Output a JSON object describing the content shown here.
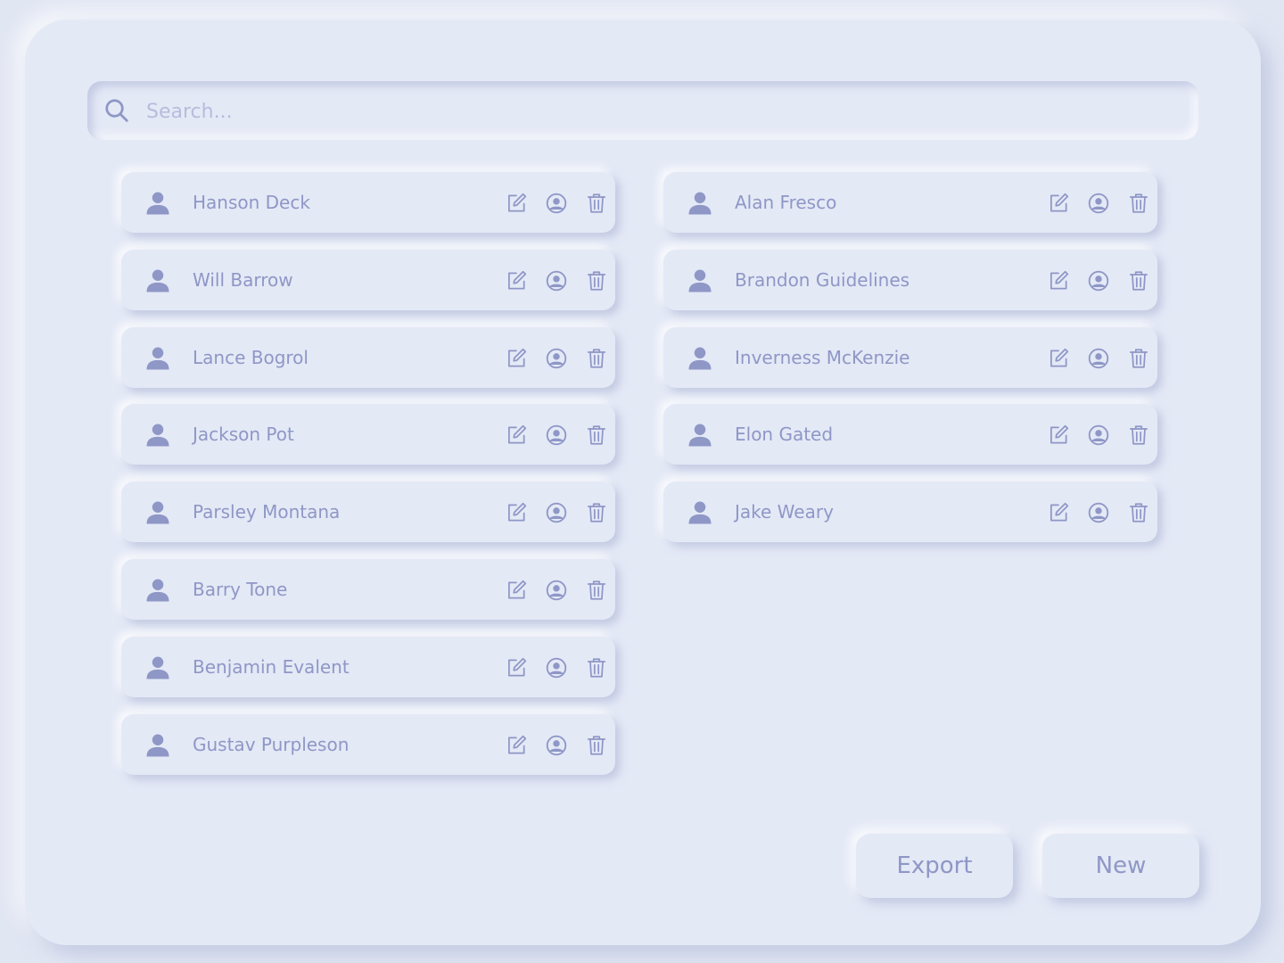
{
  "search": {
    "placeholder": "Search..."
  },
  "colors": {
    "background": "#e4e9f6",
    "text": "#8e97c6",
    "icon": "#8e97c6",
    "placeholder": "#b6bddc"
  },
  "contacts_left": [
    {
      "name": "Hanson Deck"
    },
    {
      "name": "Will Barrow"
    },
    {
      "name": "Lance Bogrol"
    },
    {
      "name": "Jackson Pot"
    },
    {
      "name": "Parsley Montana"
    },
    {
      "name": "Barry Tone"
    },
    {
      "name": "Benjamin Evalent"
    },
    {
      "name": "Gustav Purpleson"
    }
  ],
  "contacts_right": [
    {
      "name": "Alan Fresco"
    },
    {
      "name": "Brandon Guidelines"
    },
    {
      "name": "Inverness McKenzie"
    },
    {
      "name": "Elon Gated"
    },
    {
      "name": "Jake Weary"
    }
  ],
  "row_icons": [
    "user-icon",
    "edit-icon",
    "profile-icon",
    "trash-icon"
  ],
  "actions": {
    "export_label": "Export",
    "new_label": "New"
  }
}
